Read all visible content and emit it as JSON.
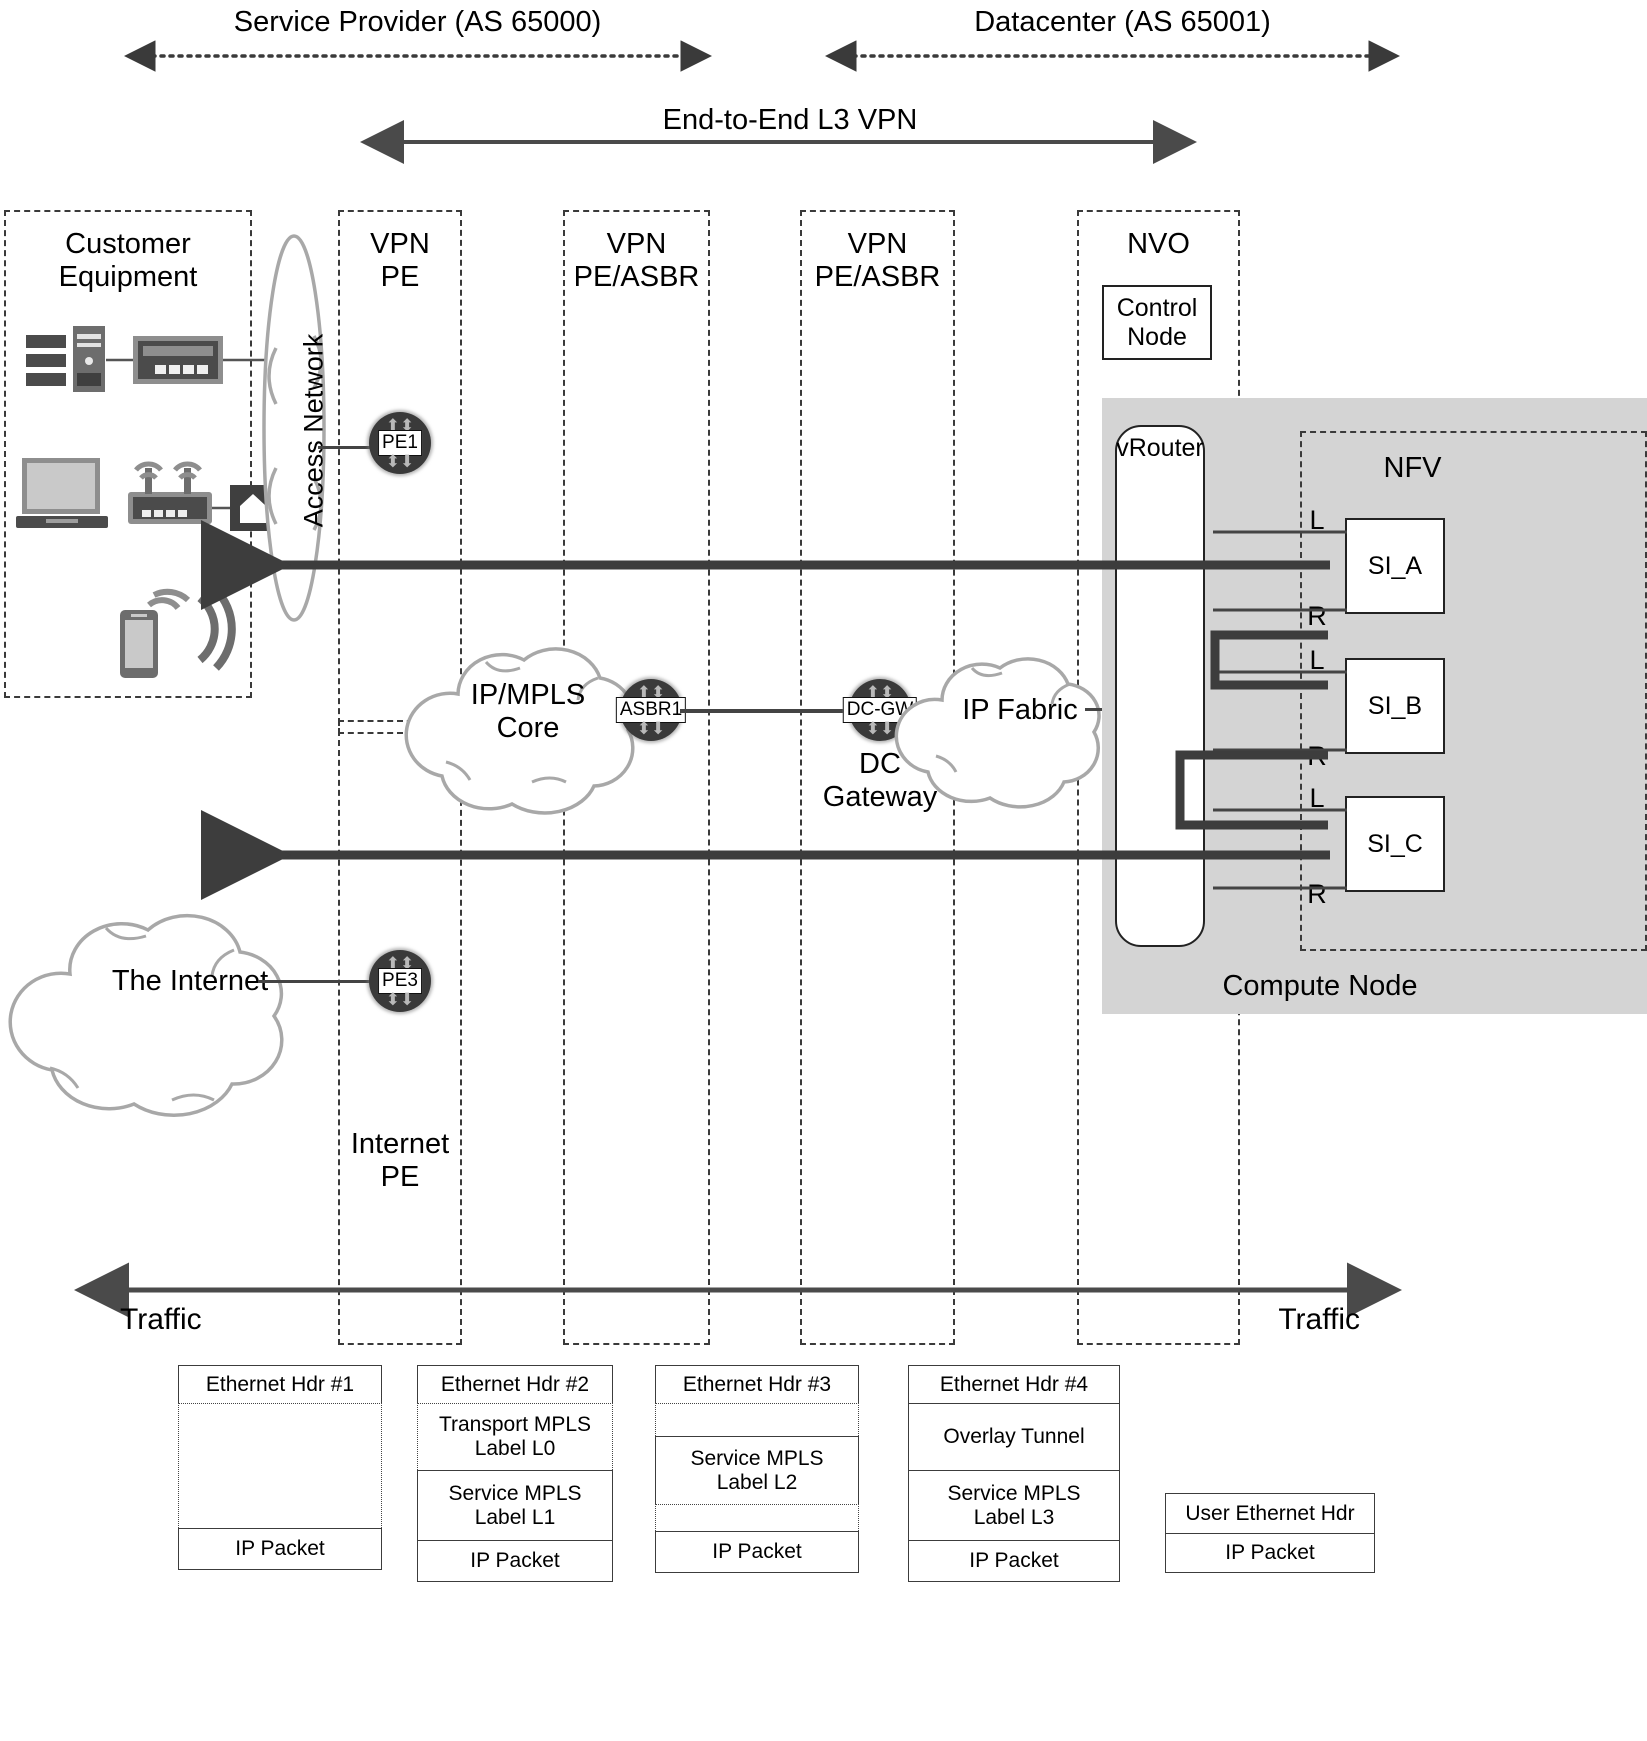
{
  "headers": {
    "service_provider": "Service Provider (AS 65000)",
    "datacenter": "Datacenter (AS 65001)",
    "e2e_vpn": "End-to-End L3 VPN"
  },
  "columns": [
    {
      "id": "customer-equipment",
      "label": "Customer\nEquipment"
    },
    {
      "id": "vpn-pe",
      "label": "VPN\nPE"
    },
    {
      "id": "vpn-pe-asbr-1",
      "label": "VPN\nPE/ASBR"
    },
    {
      "id": "vpn-pe-asbr-2",
      "label": "VPN\nPE/ASBR"
    },
    {
      "id": "nvo",
      "label": "NVO"
    },
    {
      "id": "internet-pe",
      "label": "Internet\nPE"
    }
  ],
  "nodes": {
    "access_network": "Access Network",
    "pe1": "PE1",
    "pe3": "PE3",
    "asbr1": "ASBR1",
    "dc_gw": "DC-GW",
    "dc_gateway_caption": "DC\nGateway",
    "ip_mpls_core": "IP/MPLS\nCore",
    "ip_fabric": "IP Fabric",
    "the_internet": "The Internet",
    "control_node": "Control\nNode",
    "vrouter": "vRouter",
    "nfv": "NFV",
    "compute_node": "Compute Node"
  },
  "service_instances": [
    {
      "name": "SI_A",
      "left_port": "L",
      "right_port": "R"
    },
    {
      "name": "SI_B",
      "left_port": "L",
      "right_port": "R"
    },
    {
      "name": "SI_C",
      "left_port": "L",
      "right_port": "R"
    }
  ],
  "traffic": {
    "left_label": "Traffic",
    "right_label": "Traffic"
  },
  "packet_stacks": [
    {
      "id": "stack-1",
      "layers": [
        {
          "text": "Ethernet Hdr #1",
          "style": "solid"
        },
        {
          "text": "",
          "style": "dotted"
        },
        {
          "text": "IP Packet",
          "style": "solid"
        }
      ]
    },
    {
      "id": "stack-2",
      "layers": [
        {
          "text": "Ethernet Hdr #2",
          "style": "solid"
        },
        {
          "text": "Transport MPLS\nLabel L0",
          "style": "dotted"
        },
        {
          "text": "Service MPLS\nLabel L1",
          "style": "solid"
        },
        {
          "text": "IP  Packet",
          "style": "solid"
        }
      ]
    },
    {
      "id": "stack-3",
      "layers": [
        {
          "text": "Ethernet Hdr #3",
          "style": "solid"
        },
        {
          "text": "",
          "style": "dotted"
        },
        {
          "text": "Service MPLS\nLabel L2",
          "style": "solid"
        },
        {
          "text": "",
          "style": "dotted"
        },
        {
          "text": "IP Packet",
          "style": "solid"
        }
      ]
    },
    {
      "id": "stack-4",
      "layers": [
        {
          "text": "Ethernet Hdr #4",
          "style": "solid"
        },
        {
          "text": "Overlay Tunnel",
          "style": "solid"
        },
        {
          "text": "Service MPLS\nLabel L3",
          "style": "solid"
        },
        {
          "text": "IP Packet",
          "style": "solid"
        }
      ]
    },
    {
      "id": "stack-5",
      "layers": [
        {
          "text": "User Ethernet Hdr",
          "style": "solid"
        },
        {
          "text": "IP Packet",
          "style": "solid"
        }
      ]
    }
  ],
  "colors": {
    "cloud_stroke": "#a8a8a8",
    "dashed": "#3a3a3a",
    "thick_line": "#3d3d3d",
    "compute_bg": "#d4d4d4",
    "router_fill": "#3a3a3a"
  }
}
